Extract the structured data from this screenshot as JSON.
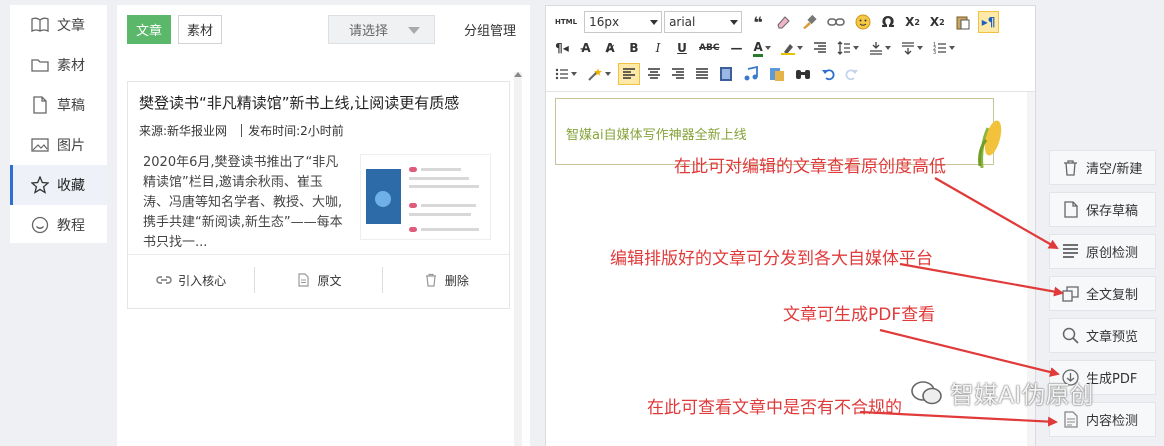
{
  "sidebar": {
    "items": [
      {
        "label": "文章",
        "icon": "book-icon",
        "active": false
      },
      {
        "label": "素材",
        "icon": "folder-icon",
        "active": false
      },
      {
        "label": "草稿",
        "icon": "file-icon",
        "active": false
      },
      {
        "label": "图片",
        "icon": "image-icon",
        "active": false
      },
      {
        "label": "收藏",
        "icon": "star-icon",
        "active": true
      },
      {
        "label": "教程",
        "icon": "smile-icon",
        "active": false
      }
    ]
  },
  "library": {
    "tabs": [
      {
        "label": "文章",
        "active": true
      },
      {
        "label": "素材",
        "active": false
      }
    ],
    "select": {
      "placeholder": "请选择"
    },
    "group_manage_label": "分组管理",
    "card": {
      "title": "樊登读书“非凡精读馆”新书上线,让阅读更有质感",
      "source_label": "来源:",
      "source": "新华报业网",
      "time_label": "发布时间:",
      "time": "2小时前",
      "summary": "2020年6月,樊登读书推出了“非凡精读馆”栏目,邀请余秋雨、崔玉涛、冯唐等知名学者、教授、大咖,携手共建“新阅读,新生态”——每本书只找一...",
      "actions": {
        "import": "引入核心",
        "original": "原文",
        "delete": "删除"
      }
    }
  },
  "editor": {
    "font_size": "16px",
    "font_family": "arial",
    "banner_text": "智媒ai自媒体写作神器全新上线"
  },
  "right_buttons": [
    {
      "label": "清空/新建",
      "icon": "trash-icon"
    },
    {
      "label": "保存草稿",
      "icon": "document-icon"
    },
    {
      "label": "原创检测",
      "icon": "lines-icon"
    },
    {
      "label": "全文复制",
      "icon": "copy-icon"
    },
    {
      "label": "文章预览",
      "icon": "magnifier-icon"
    },
    {
      "label": "生成PDF",
      "icon": "download-icon"
    },
    {
      "label": "内容检测",
      "icon": "doc-check-icon"
    }
  ],
  "annotations": {
    "a1": "在此可对编辑的文章查看原创度高低",
    "a2": "编辑排版好的文章可分发到各大自媒体平台",
    "a3": "文章可生成PDF查看",
    "a4": "在此可查看文章中是否有不合规的"
  },
  "watermark": "智媒AI伪原创",
  "colors": {
    "accent_green": "#5bb86b",
    "annotation_red": "#e03a3a",
    "active_blue": "#2f6fd1"
  }
}
